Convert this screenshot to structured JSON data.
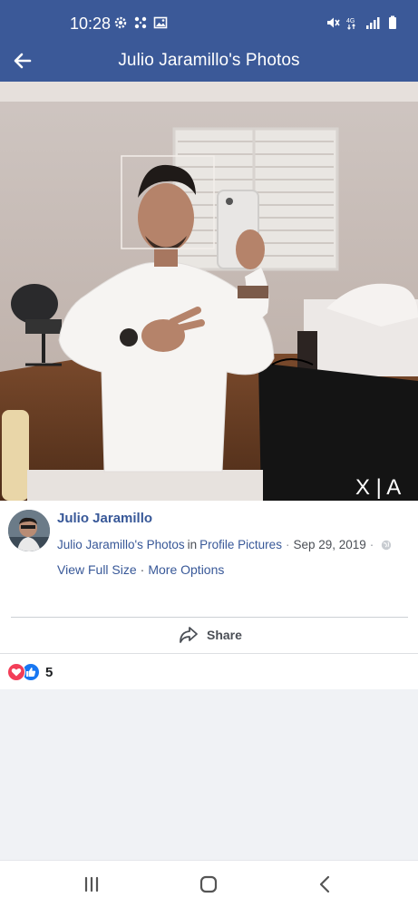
{
  "status_bar": {
    "time": "10:28",
    "left_icons": [
      "gear-icon",
      "dots-grid-icon",
      "image-icon"
    ],
    "right_icons": [
      "mute-icon",
      "data-icon",
      "signal-icon",
      "battery-icon"
    ]
  },
  "app_bar": {
    "title": "Julio Jaramillo's Photos",
    "back_icon": "arrow-left-icon",
    "color": "#3b5998"
  },
  "photo": {
    "watermark": "X | A"
  },
  "post": {
    "author": "Julio Jaramillo",
    "album_link": "Julio Jaramillo's Photos",
    "in_text": "in",
    "album_name": "Profile Pictures",
    "date": "Sep 29, 2019",
    "privacy_icon": "globe-icon",
    "view_full_size": "View Full Size",
    "more_options": "More Options",
    "separator": "·"
  },
  "share": {
    "label": "Share",
    "icon": "share-arrow-icon"
  },
  "reactions": {
    "count": "5",
    "types": [
      "love",
      "like"
    ]
  },
  "nav": {
    "items": [
      "recent-apps-icon",
      "home-icon",
      "back-icon"
    ]
  }
}
